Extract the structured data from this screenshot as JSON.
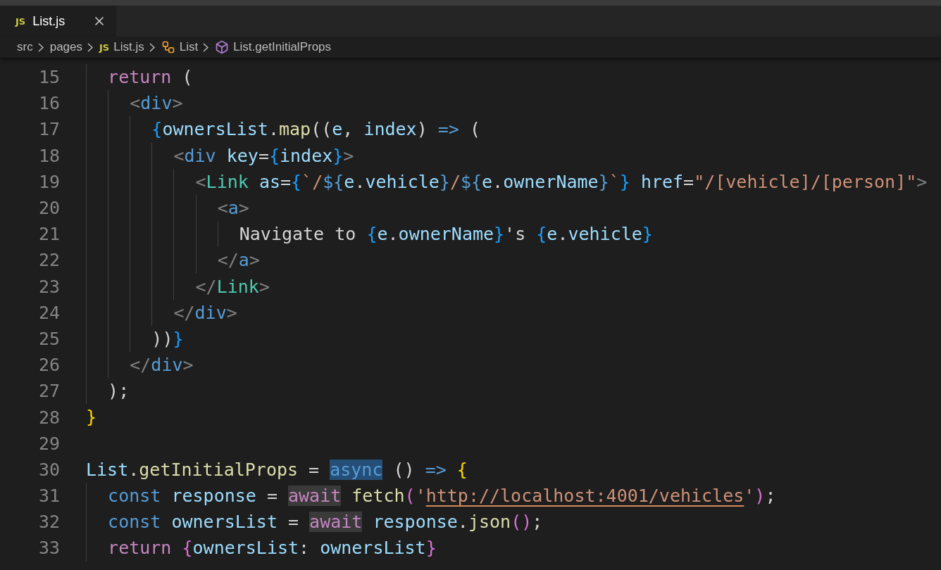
{
  "tabs": [
    {
      "icon_text": "JS",
      "label": "List.js",
      "selected": true
    }
  ],
  "breadcrumb": [
    {
      "kind": "folder",
      "label": "src"
    },
    {
      "kind": "folder",
      "label": "pages"
    },
    {
      "kind": "file",
      "icon_text": "JS",
      "label": "List.js"
    },
    {
      "kind": "class",
      "label": "List"
    },
    {
      "kind": "method",
      "label": "List.getInitialProps"
    }
  ],
  "lines": [
    {
      "number": "15",
      "tokens": [
        {
          "text": "  return",
          "kind": "control"
        },
        {
          "text": " (",
          "kind": "punct"
        }
      ]
    },
    {
      "number": "16",
      "tokens": [
        {
          "text": "    <",
          "kind": "tagbracket"
        },
        {
          "text": "div",
          "kind": "tag"
        },
        {
          "text": ">",
          "kind": "tagbracket"
        }
      ]
    },
    {
      "number": "17",
      "tokens": [
        {
          "text": "      {",
          "kind": "brace3"
        },
        {
          "text": "ownersList",
          "kind": "variable"
        },
        {
          "text": ".",
          "kind": "punct"
        },
        {
          "text": "map",
          "kind": "function"
        },
        {
          "text": "((",
          "kind": "punct"
        },
        {
          "text": "e",
          "kind": "variable"
        },
        {
          "text": ", ",
          "kind": "punct"
        },
        {
          "text": "index",
          "kind": "variable"
        },
        {
          "text": ") ",
          "kind": "punct"
        },
        {
          "text": "=>",
          "kind": "keyword"
        },
        {
          "text": " (",
          "kind": "punct"
        }
      ]
    },
    {
      "number": "18",
      "tokens": [
        {
          "text": "        <",
          "kind": "tagbracket"
        },
        {
          "text": "div",
          "kind": "tag"
        },
        {
          "text": " key",
          "kind": "variable"
        },
        {
          "text": "=",
          "kind": "punct"
        },
        {
          "text": "{",
          "kind": "brace3"
        },
        {
          "text": "index",
          "kind": "variable"
        },
        {
          "text": "}",
          "kind": "brace3"
        },
        {
          "text": ">",
          "kind": "tagbracket"
        }
      ]
    },
    {
      "number": "19",
      "tokens": [
        {
          "text": "          <",
          "kind": "tagbracket"
        },
        {
          "text": "Link",
          "kind": "component"
        },
        {
          "text": " as",
          "kind": "variable"
        },
        {
          "text": "=",
          "kind": "punct"
        },
        {
          "text": "{",
          "kind": "brace3"
        },
        {
          "text": "`/",
          "kind": "string"
        },
        {
          "text": "${",
          "kind": "keyword"
        },
        {
          "text": "e",
          "kind": "variable"
        },
        {
          "text": ".",
          "kind": "punct"
        },
        {
          "text": "vehicle",
          "kind": "variable"
        },
        {
          "text": "}",
          "kind": "keyword"
        },
        {
          "text": "/",
          "kind": "string"
        },
        {
          "text": "${",
          "kind": "keyword"
        },
        {
          "text": "e",
          "kind": "variable"
        },
        {
          "text": ".",
          "kind": "punct"
        },
        {
          "text": "ownerName",
          "kind": "variable"
        },
        {
          "text": "}",
          "kind": "keyword"
        },
        {
          "text": "`",
          "kind": "string"
        },
        {
          "text": "}",
          "kind": "brace3"
        },
        {
          "text": " href",
          "kind": "variable"
        },
        {
          "text": "=",
          "kind": "punct"
        },
        {
          "text": "\"/[vehicle]/[person]\"",
          "kind": "string"
        },
        {
          "text": ">",
          "kind": "tagbracket"
        }
      ]
    },
    {
      "number": "20",
      "tokens": [
        {
          "text": "            <",
          "kind": "tagbracket"
        },
        {
          "text": "a",
          "kind": "tag"
        },
        {
          "text": ">",
          "kind": "tagbracket"
        }
      ]
    },
    {
      "number": "21",
      "tokens": [
        {
          "text": "              Navigate to ",
          "kind": "punct"
        },
        {
          "text": "{",
          "kind": "brace3"
        },
        {
          "text": "e",
          "kind": "variable"
        },
        {
          "text": ".",
          "kind": "punct"
        },
        {
          "text": "ownerName",
          "kind": "variable"
        },
        {
          "text": "}",
          "kind": "brace3"
        },
        {
          "text": "'s ",
          "kind": "punct"
        },
        {
          "text": "{",
          "kind": "brace3"
        },
        {
          "text": "e",
          "kind": "variable"
        },
        {
          "text": ".",
          "kind": "punct"
        },
        {
          "text": "vehicle",
          "kind": "variable"
        },
        {
          "text": "}",
          "kind": "brace3"
        }
      ]
    },
    {
      "number": "22",
      "tokens": [
        {
          "text": "            </",
          "kind": "tagbracket"
        },
        {
          "text": "a",
          "kind": "tag"
        },
        {
          "text": ">",
          "kind": "tagbracket"
        }
      ]
    },
    {
      "number": "23",
      "tokens": [
        {
          "text": "          </",
          "kind": "tagbracket"
        },
        {
          "text": "Link",
          "kind": "component"
        },
        {
          "text": ">",
          "kind": "tagbracket"
        }
      ]
    },
    {
      "number": "24",
      "tokens": [
        {
          "text": "        </",
          "kind": "tagbracket"
        },
        {
          "text": "div",
          "kind": "tag"
        },
        {
          "text": ">",
          "kind": "tagbracket"
        }
      ]
    },
    {
      "number": "25",
      "tokens": [
        {
          "text": "      ))",
          "kind": "punct"
        },
        {
          "text": "}",
          "kind": "brace3"
        }
      ]
    },
    {
      "number": "26",
      "tokens": [
        {
          "text": "    </",
          "kind": "tagbracket"
        },
        {
          "text": "div",
          "kind": "tag"
        },
        {
          "text": ">",
          "kind": "tagbracket"
        }
      ]
    },
    {
      "number": "27",
      "tokens": [
        {
          "text": "  );",
          "kind": "punct"
        }
      ]
    },
    {
      "number": "28",
      "tokens": [
        {
          "text": "}",
          "kind": "brace1"
        }
      ]
    },
    {
      "number": "29"
    },
    {
      "number": "30",
      "tokens": [
        {
          "text": "List",
          "kind": "variable"
        },
        {
          "text": ".",
          "kind": "punct"
        },
        {
          "text": "getInitialProps",
          "kind": "function"
        },
        {
          "text": " = ",
          "kind": "punct"
        },
        {
          "text": "async",
          "kind": "selection"
        },
        {
          "text": " () ",
          "kind": "punct"
        },
        {
          "text": "=>",
          "kind": "keyword"
        },
        {
          "text": " {",
          "kind": "brace1"
        }
      ]
    },
    {
      "number": "31",
      "tokens": [
        {
          "text": "  const",
          "kind": "keyword"
        },
        {
          "text": " response",
          "kind": "variable"
        },
        {
          "text": " = ",
          "kind": "punct"
        },
        {
          "text": "await",
          "kind": "occurrence"
        },
        {
          "text": " fetch",
          "kind": "function"
        },
        {
          "text": "(",
          "kind": "brace2"
        },
        {
          "text": "'",
          "kind": "string"
        },
        {
          "text": "http://localhost:4001/vehicles",
          "kind": "url"
        },
        {
          "text": "'",
          "kind": "string"
        },
        {
          "text": ")",
          "kind": "brace2"
        },
        {
          "text": ";",
          "kind": "punct"
        }
      ]
    },
    {
      "number": "32",
      "tokens": [
        {
          "text": "  const",
          "kind": "keyword"
        },
        {
          "text": " ownersList",
          "kind": "variable"
        },
        {
          "text": " = ",
          "kind": "punct"
        },
        {
          "text": "await",
          "kind": "occurrence"
        },
        {
          "text": " response",
          "kind": "variable"
        },
        {
          "text": ".",
          "kind": "punct"
        },
        {
          "text": "json",
          "kind": "function"
        },
        {
          "text": "()",
          "kind": "brace2"
        },
        {
          "text": ";",
          "kind": "punct"
        }
      ]
    },
    {
      "number": "33",
      "tokens": [
        {
          "text": "  return",
          "kind": "control"
        },
        {
          "text": " {",
          "kind": "brace2"
        },
        {
          "text": "ownersList",
          "kind": "variable"
        },
        {
          "text": ": ",
          "kind": "punct"
        },
        {
          "text": "ownersList",
          "kind": "variable"
        },
        {
          "text": "}",
          "kind": "brace2"
        }
      ]
    }
  ]
}
